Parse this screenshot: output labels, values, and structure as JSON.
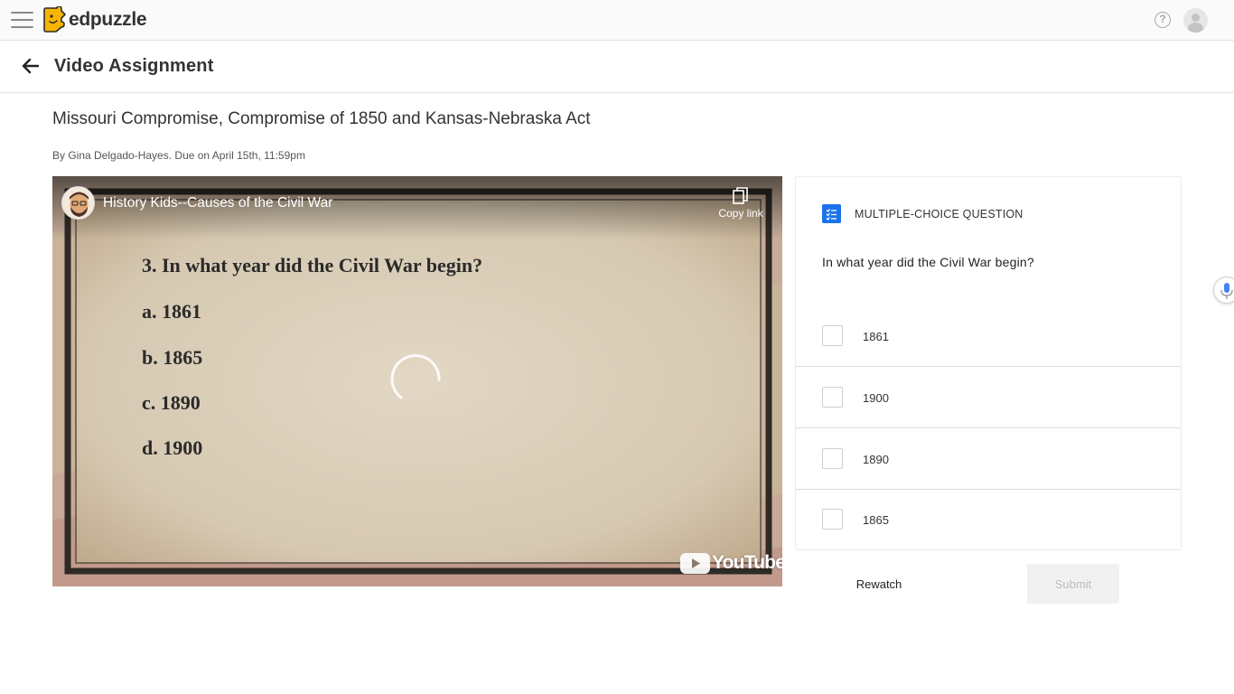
{
  "topbar": {
    "brand": "edpuzzle",
    "help_glyph": "?",
    "icons": {
      "menu": "hamburger-menu-icon",
      "help": "help-icon",
      "avatar": "user-avatar-icon"
    },
    "brand_color": "#f7b500"
  },
  "header": {
    "title": "Video Assignment",
    "back_icon": "arrow-left-icon"
  },
  "assignment": {
    "title": "Missouri Compromise, Compromise of 1850 and Kansas-Nebraska Act",
    "byline": "By Gina Delgado-Hayes. Due on April 15th, 11:59pm"
  },
  "video": {
    "youtube_title": "History Kids--Causes of the Civil War",
    "copy_link_label": "Copy link",
    "youtube_brand": "YouTube",
    "on_screen_question": "3. In what year did the Civil War begin?",
    "on_screen_options": [
      "a. 1861",
      "b. 1865",
      "c. 1890",
      "d. 1900"
    ],
    "loading": true
  },
  "question": {
    "type_label": "MULTIPLE-CHOICE QUESTION",
    "text": "In what year did the Civil War begin?",
    "options": [
      {
        "label": "1861",
        "checked": false
      },
      {
        "label": "1900",
        "checked": false
      },
      {
        "label": "1890",
        "checked": false
      },
      {
        "label": "1865",
        "checked": false
      }
    ],
    "accent_color": "#1a73e8"
  },
  "actions": {
    "rewatch_label": "Rewatch",
    "submit_label": "Submit",
    "submit_enabled": false
  }
}
